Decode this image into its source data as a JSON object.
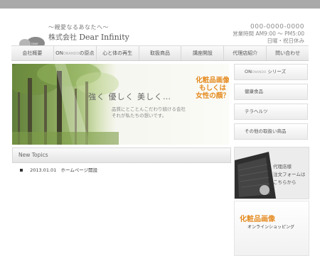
{
  "header": {
    "tagline": "〜親愛なるあなたへ〜",
    "company_prefix": "株式会社",
    "company_name": "Dear Infinity",
    "tel": "000-0000-0000",
    "hours": "営業時間 AM9:00 〜 PM5:00",
    "holidays": "日曜・祝日休み"
  },
  "nav": {
    "items": [
      {
        "label": "会社概要"
      },
      {
        "label": "ONの原点",
        "prefix": "ON",
        "small": "ONANDO",
        "suffix": "の原点"
      },
      {
        "label": "心と体の再生"
      },
      {
        "label": "取扱商品"
      },
      {
        "label": "講座開設"
      },
      {
        "label": "代理店紹介"
      },
      {
        "label": "問い合わせ"
      }
    ]
  },
  "hero": {
    "slogan": "強く 優しく 美しく…",
    "sub_line1": "品質にとことんこだわり続ける会社",
    "sub_line2": "それが私たちの想いです。",
    "accent_line1": "化粧品画像",
    "accent_line2": "もしくは",
    "accent_line3": "女性の顔？"
  },
  "side_menu": {
    "items": [
      {
        "label": "ONシリーズ",
        "prefix": "ON",
        "small": "ONANDO",
        "suffix": " シリーズ"
      },
      {
        "label": "健康食品"
      },
      {
        "label": "テラヘルツ"
      },
      {
        "label": "その他の取扱い商品"
      }
    ]
  },
  "news": {
    "title": "New Topics",
    "items": [
      {
        "date": "2013.01.01",
        "text": "ホームページ開設"
      }
    ]
  },
  "banner_form": {
    "line1": "代理店様",
    "line2": "注文フォームは",
    "line3": "こちらから"
  },
  "banner_cosmetics": {
    "title": "化粧品画像",
    "subtitle": "オンラインショッピング"
  },
  "colors": {
    "accent": "#e58a1e",
    "topbar": "#a9a9a9",
    "text": "#555555"
  }
}
